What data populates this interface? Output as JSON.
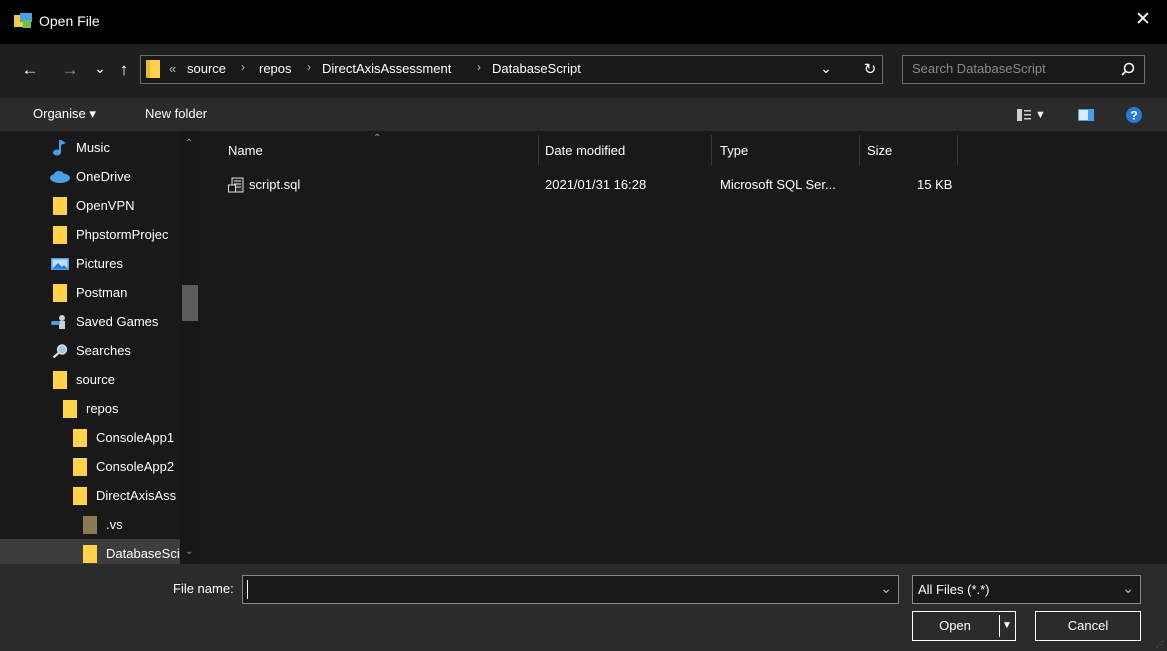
{
  "window": {
    "title": "Open File",
    "close_glyph": "✕"
  },
  "nav": {
    "back": "←",
    "forward": "→",
    "recent": "⌄",
    "up": "↑",
    "breadcrumb_overflow": "«",
    "crumbs": [
      "source",
      "repos",
      "DirectAxisAssessment",
      "DatabaseScript"
    ],
    "separator": "›",
    "dropdown": "⌄",
    "refresh": "↻",
    "search_placeholder": "Search DatabaseScript",
    "search_icon": "⌕"
  },
  "commandbar": {
    "organise": "Organise ▾",
    "new_folder": "New folder"
  },
  "sidebar": {
    "items": [
      {
        "label": "Music",
        "icon": "music-icon"
      },
      {
        "label": "OneDrive",
        "icon": "cloud-icon"
      },
      {
        "label": "OpenVPN",
        "icon": "folder-icon"
      },
      {
        "label": "PhpstormProjec",
        "icon": "folder-icon"
      },
      {
        "label": "Pictures",
        "icon": "pictures-icon"
      },
      {
        "label": "Postman",
        "icon": "folder-icon"
      },
      {
        "label": "Saved Games",
        "icon": "saved-games-icon"
      },
      {
        "label": "Searches",
        "icon": "search-icon"
      },
      {
        "label": "source",
        "icon": "folder-icon"
      },
      {
        "label": "repos",
        "icon": "folder-icon"
      },
      {
        "label": "ConsoleApp1",
        "icon": "folder-icon"
      },
      {
        "label": "ConsoleApp2",
        "icon": "folder-icon"
      },
      {
        "label": "DirectAxisAss",
        "icon": "folder-icon"
      },
      {
        "label": ".vs",
        "icon": "folder-icon"
      },
      {
        "label": "DatabaseSci",
        "icon": "folder-icon"
      }
    ]
  },
  "files": {
    "columns": [
      "Name",
      "Date modified",
      "Type",
      "Size"
    ],
    "rows": [
      {
        "name": "script.sql",
        "date": "2021/01/31 16:28",
        "type": "Microsoft SQL Ser...",
        "size": "15 KB"
      }
    ]
  },
  "footer": {
    "filename_label": "File name:",
    "filename_value": "",
    "filetype": "All Files (*.*)",
    "open": "Open",
    "cancel": "Cancel"
  },
  "colors": {
    "folder": "#ffd24a",
    "accent": "#2a7ad5"
  }
}
